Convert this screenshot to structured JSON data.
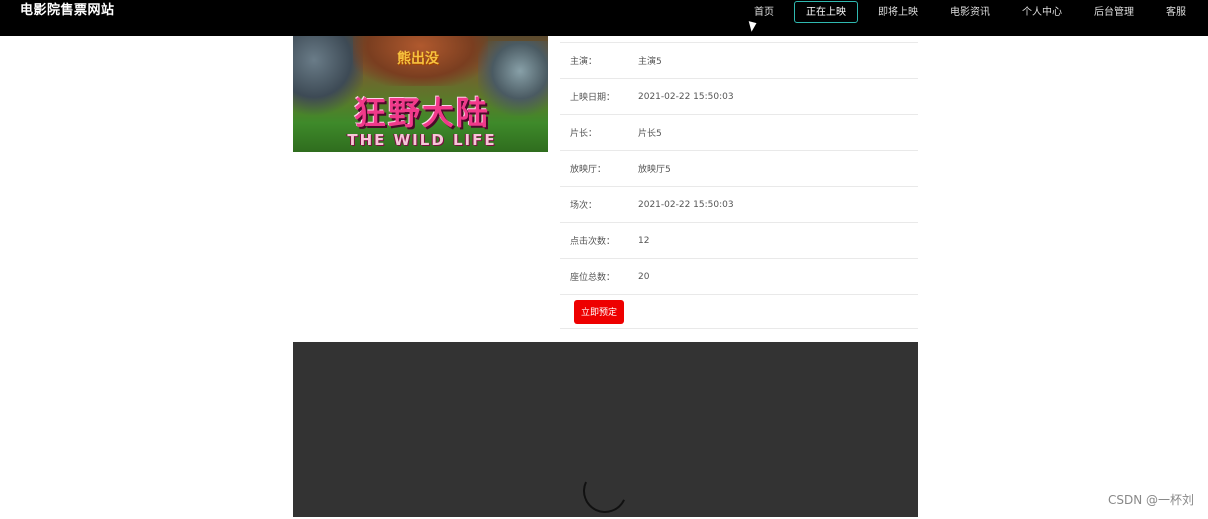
{
  "header": {
    "brand": "电影院售票网站",
    "nav": [
      {
        "label": "首页",
        "active": false
      },
      {
        "label": "正在上映",
        "active": true
      },
      {
        "label": "即将上映",
        "active": false
      },
      {
        "label": "电影资讯",
        "active": false
      },
      {
        "label": "个人中心",
        "active": false
      },
      {
        "label": "后台管理",
        "active": false
      },
      {
        "label": "客服",
        "active": false
      }
    ],
    "active_color": "#2fb9b0"
  },
  "poster": {
    "sub_title": "熊出没",
    "main_title": "狂野大陆",
    "en_title": "THE WILD LIFE"
  },
  "details": [
    {
      "label": "主演：",
      "value": "主演5"
    },
    {
      "label": "上映日期：",
      "value": "2021-02-22 15:50:03"
    },
    {
      "label": "片长：",
      "value": "片长5"
    },
    {
      "label": "放映厅：",
      "value": "放映厅5"
    },
    {
      "label": "场次：",
      "value": "2021-02-22 15:50:03"
    },
    {
      "label": "点击次数：",
      "value": "12"
    },
    {
      "label": "座位总数：",
      "value": "20"
    }
  ],
  "actions": {
    "book_label": "立即预定",
    "book_color": "#ee0000"
  },
  "watermark": "CSDN @一杯刘"
}
